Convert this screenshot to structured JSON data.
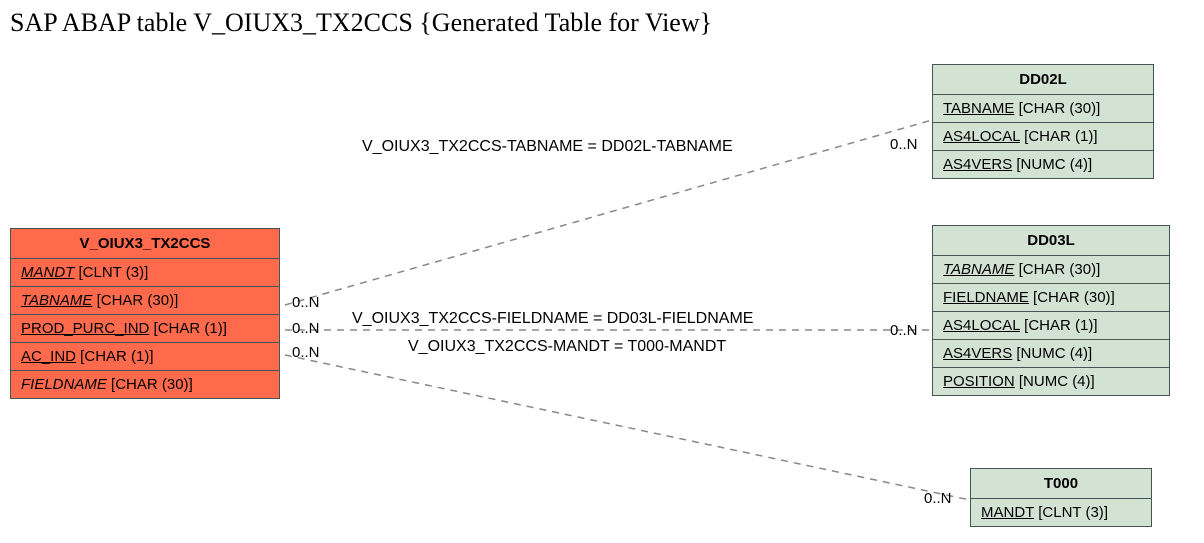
{
  "title": "SAP ABAP table V_OIUX3_TX2CCS {Generated Table for View}",
  "main_table": {
    "name": "V_OIUX3_TX2CCS",
    "fields": [
      {
        "name": "MANDT",
        "type": "CLNT (3)",
        "key": true,
        "fk": true
      },
      {
        "name": "TABNAME",
        "type": "CHAR (30)",
        "key": true,
        "fk": true
      },
      {
        "name": "PROD_PURC_IND",
        "type": "CHAR (1)",
        "key": true,
        "fk": false
      },
      {
        "name": "AC_IND",
        "type": "CHAR (1)",
        "key": true,
        "fk": false
      },
      {
        "name": "FIELDNAME",
        "type": "CHAR (30)",
        "key": false,
        "fk": true
      }
    ]
  },
  "related_tables": [
    {
      "name": "DD02L",
      "fields": [
        {
          "name": "TABNAME",
          "type": "CHAR (30)",
          "key": true
        },
        {
          "name": "AS4LOCAL",
          "type": "CHAR (1)",
          "key": true
        },
        {
          "name": "AS4VERS",
          "type": "NUMC (4)",
          "key": true
        }
      ]
    },
    {
      "name": "DD03L",
      "fields": [
        {
          "name": "TABNAME",
          "type": "CHAR (30)",
          "key": true,
          "italic": true
        },
        {
          "name": "FIELDNAME",
          "type": "CHAR (30)",
          "key": true
        },
        {
          "name": "AS4LOCAL",
          "type": "CHAR (1)",
          "key": true
        },
        {
          "name": "AS4VERS",
          "type": "NUMC (4)",
          "key": true
        },
        {
          "name": "POSITION",
          "type": "NUMC (4)",
          "key": true
        }
      ]
    },
    {
      "name": "T000",
      "fields": [
        {
          "name": "MANDT",
          "type": "CLNT (3)",
          "key": true
        }
      ]
    }
  ],
  "relations": [
    {
      "label": "V_OIUX3_TX2CCS-TABNAME = DD02L-TABNAME",
      "left_card": "0..N",
      "right_card": "0..N"
    },
    {
      "label": "V_OIUX3_TX2CCS-FIELDNAME = DD03L-FIELDNAME",
      "left_card": "0..N",
      "right_card": "0..N"
    },
    {
      "label": "V_OIUX3_TX2CCS-MANDT = T000-MANDT",
      "left_card": "0..N",
      "right_card": "0..N"
    }
  ],
  "cards": {
    "c1": "0..N",
    "c2": "0..N",
    "c3": "0..N",
    "c4": "0..N",
    "c5": "0..N",
    "c6": "0..N"
  }
}
